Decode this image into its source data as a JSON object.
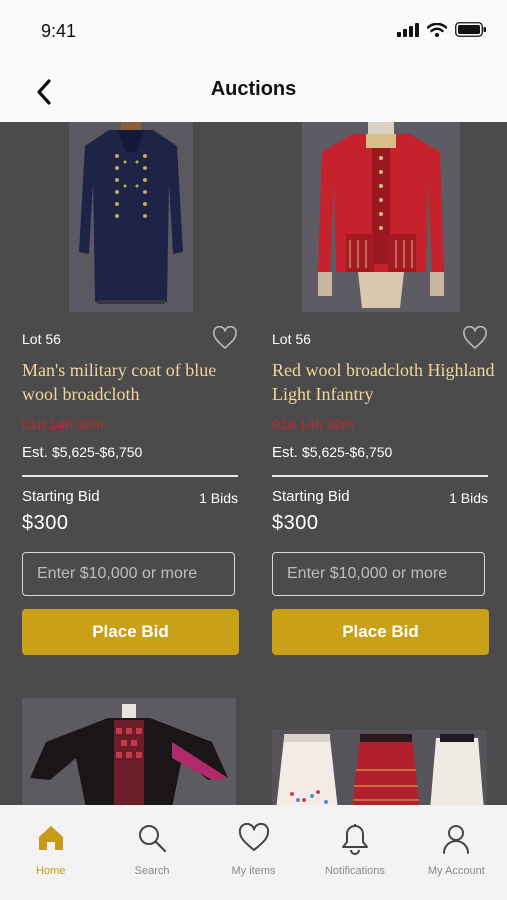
{
  "status": {
    "time": "9:41"
  },
  "nav": {
    "title": "Auctions"
  },
  "lots": [
    {
      "lot": "Lot 56",
      "title": "Man's military coat of blue wool broadcloth",
      "date": "01d 14h 32m",
      "est_label": "Est.",
      "est_range": "$5,625-$6,750",
      "starting_bid_label": "Starting Bid",
      "bids": "1 Bids",
      "starting_bid": "$300",
      "input_placeholder": "Enter $10,000 or more",
      "button_label": "Place Bid",
      "image": "blue-military-coat"
    },
    {
      "lot": "Lot 56",
      "title": "Red wool broadcloth Highland Light Infantry",
      "date": "01d 14h 32m",
      "est_label": "Est.",
      "est_range": "$5,625-$6,750",
      "starting_bid_label": "Starting Bid",
      "bids": "1 Bids",
      "starting_bid": "$300",
      "input_placeholder": "Enter $10,000 or more",
      "button_label": "Place Bid",
      "image": "red-infantry-jacket"
    }
  ],
  "tabs": [
    {
      "label": "Home",
      "icon": "home-icon"
    },
    {
      "label": "Search",
      "icon": "search-icon"
    },
    {
      "label": "My items",
      "icon": "heart-icon"
    },
    {
      "label": "Notifications",
      "icon": "bell-icon"
    },
    {
      "label": "My Account",
      "icon": "user-icon"
    }
  ],
  "colors": {
    "accent": "#caa017",
    "title": "#f0d69b",
    "date": "#c0282c",
    "background": "#4b4b4b"
  }
}
